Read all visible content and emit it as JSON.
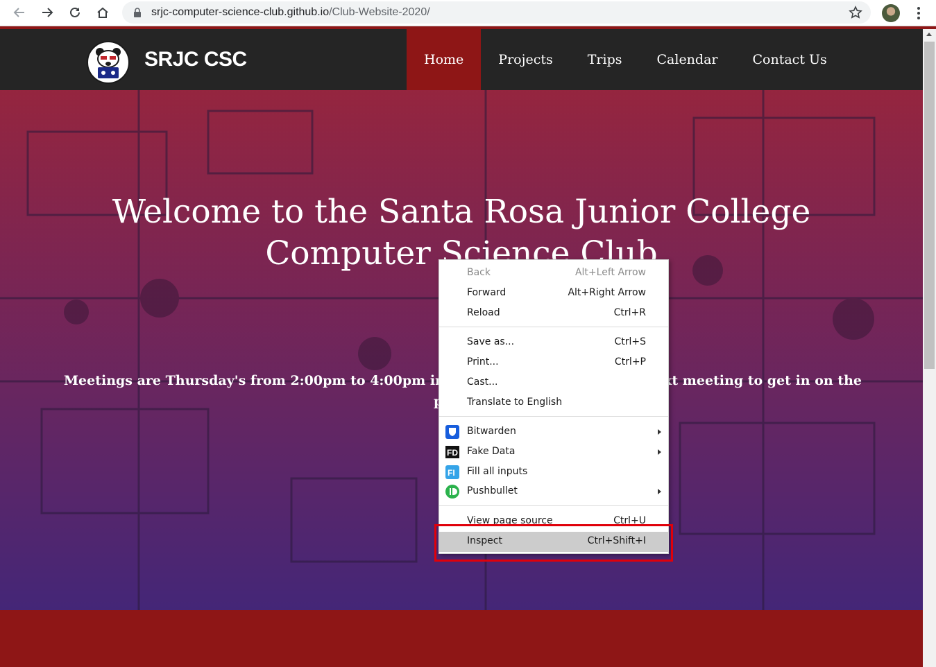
{
  "browser": {
    "url_host": "srjc-computer-science-club.github.io",
    "url_path": "/Club-Website-2020/"
  },
  "site": {
    "brand": "SRJC CSC",
    "nav": [
      "Home",
      "Projects",
      "Trips",
      "Calendar",
      "Contact Us"
    ],
    "active_nav": "Home"
  },
  "hero": {
    "title_line1": "Welcome to the Santa Rosa Junior College",
    "title_line2": "Computer Science Club",
    "meeting_text_left": "Meetings are Thursday's from 2:00pm to 4:00pm in Bussm",
    "meeting_text_right": "e next meeting to get in on the",
    "meeting_text_line2": "p"
  },
  "context_menu": {
    "items": [
      {
        "label": "Back",
        "shortcut": "Alt+Left Arrow",
        "disabled": true
      },
      {
        "label": "Forward",
        "shortcut": "Alt+Right Arrow"
      },
      {
        "label": "Reload",
        "shortcut": "Ctrl+R"
      },
      {
        "label": "Save as...",
        "shortcut": "Ctrl+S"
      },
      {
        "label": "Print...",
        "shortcut": "Ctrl+P"
      },
      {
        "label": "Cast..."
      },
      {
        "label": "Translate to English"
      },
      {
        "label": "Bitwarden",
        "submenu": true,
        "icon": "bitwarden-icon"
      },
      {
        "label": "Fake Data",
        "submenu": true,
        "icon": "fake-data-icon"
      },
      {
        "label": "Fill all inputs",
        "icon": "fill-inputs-icon"
      },
      {
        "label": "Pushbullet",
        "submenu": true,
        "icon": "pushbullet-icon"
      },
      {
        "label": "View page source",
        "shortcut": "Ctrl+U"
      },
      {
        "label": "Inspect",
        "shortcut": "Ctrl+Shift+I",
        "highlighted": true
      }
    ],
    "highlight_color": "#e0000a"
  },
  "colors": {
    "header_bg": "#252525",
    "accent_red": "#8e1616"
  }
}
